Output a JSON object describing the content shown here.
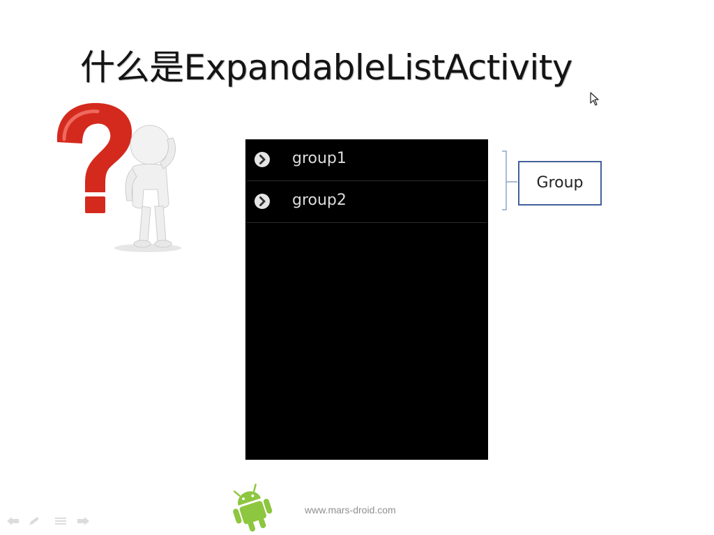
{
  "slide": {
    "title": "什么是ExpandableListActivity",
    "list": {
      "groups": [
        {
          "label": "group1"
        },
        {
          "label": "group2"
        }
      ]
    },
    "annotation_label": "Group",
    "footer_url": "www.mars-droid.com"
  },
  "colors": {
    "list_background": "#000000",
    "list_text": "#dcdcdc",
    "question_mark": "#d42a1e",
    "box_border": "#41609a",
    "android_green": "#8dc63f"
  },
  "icons": {
    "row_indicator": "chevron-right-circle-icon",
    "figure": "question-mark-figure",
    "logo": "android-logo",
    "nav": [
      "previous-icon",
      "pen-icon",
      "menu-icon",
      "next-icon"
    ]
  }
}
